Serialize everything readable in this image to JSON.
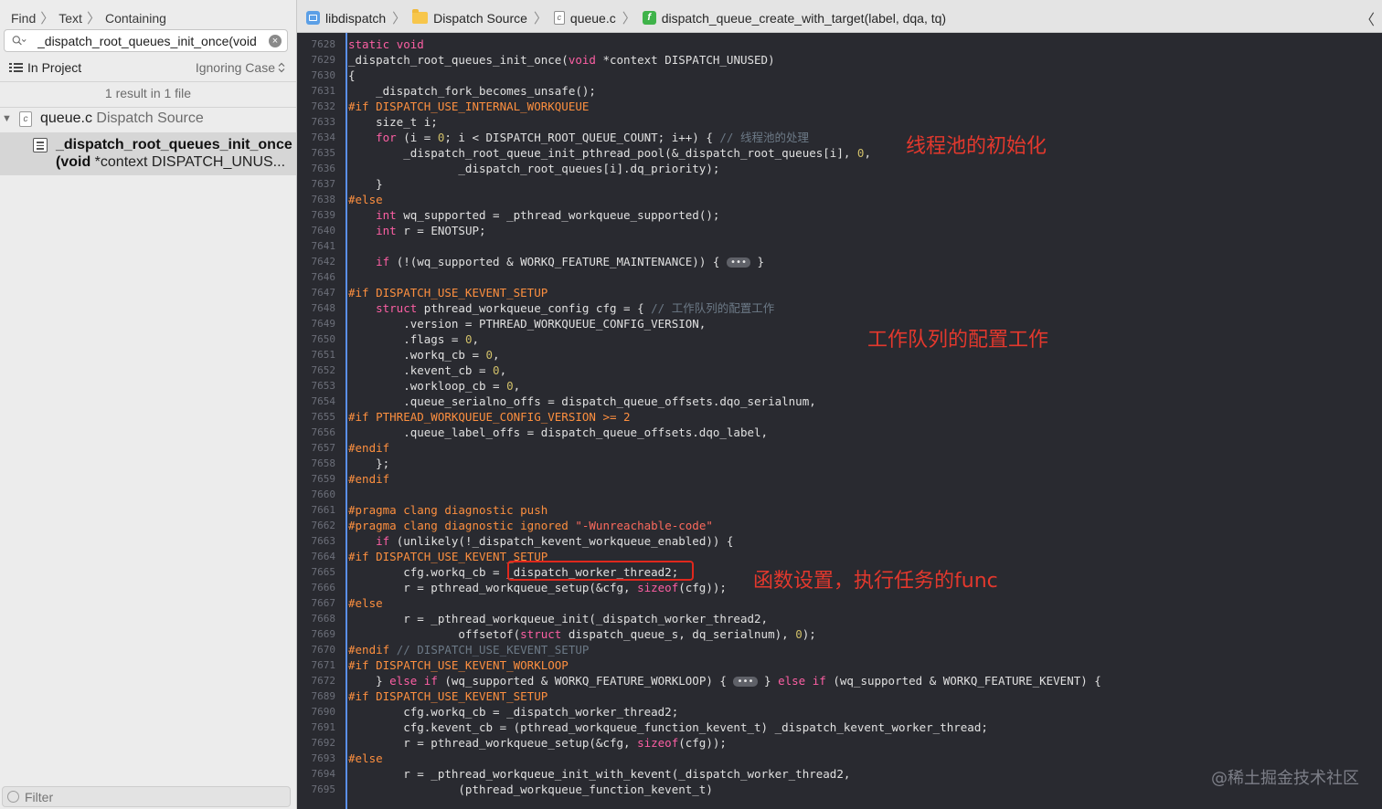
{
  "navigator": {
    "find_path": [
      "Find",
      "Text",
      "Containing"
    ],
    "search": {
      "value": "_dispatch_root_queues_init_once(void",
      "placeholder": ""
    },
    "scope": "In Project",
    "match_mode": "Ignoring Case",
    "summary": "1 result in 1 file",
    "file": {
      "name": "queue.c",
      "group": "Dispatch Source"
    },
    "result": {
      "line1": "_dispatch_root_queues_init_once",
      "line2_bold": "(void",
      "line2_rest": " *context DISPATCH_UNUS..."
    },
    "filter_placeholder": "Filter"
  },
  "jump_bar": {
    "project": "libdispatch",
    "group": "Dispatch Source",
    "file": "queue.c",
    "symbol": "dispatch_queue_create_with_target(label, dqa, tq)"
  },
  "code_lines": [
    {
      "n": "7628",
      "code": "static void"
    },
    {
      "n": "7629",
      "code": "_dispatch_root_queues_init_once(void *context DISPATCH_UNUSED)"
    },
    {
      "n": "7630",
      "code": "{"
    },
    {
      "n": "7631",
      "code": "    _dispatch_fork_becomes_unsafe();"
    },
    {
      "n": "7632",
      "code": "#if DISPATCH_USE_INTERNAL_WORKQUEUE"
    },
    {
      "n": "7633",
      "code": "    size_t i;"
    },
    {
      "n": "7634",
      "code": "    for (i = 0; i < DISPATCH_ROOT_QUEUE_COUNT; i++) { // 线程池的处理"
    },
    {
      "n": "7635",
      "code": "        _dispatch_root_queue_init_pthread_pool(&_dispatch_root_queues[i], 0,"
    },
    {
      "n": "7636",
      "code": "                _dispatch_root_queues[i].dq_priority);"
    },
    {
      "n": "7637",
      "code": "    }"
    },
    {
      "n": "7638",
      "code": "#else"
    },
    {
      "n": "7639",
      "code": "    int wq_supported = _pthread_workqueue_supported();"
    },
    {
      "n": "7640",
      "code": "    int r = ENOTSUP;"
    },
    {
      "n": "7641",
      "code": ""
    },
    {
      "n": "7642",
      "code": "    if (!(wq_supported & WORKQ_FEATURE_MAINTENANCE)) { ••• }"
    },
    {
      "n": "7646",
      "code": ""
    },
    {
      "n": "7647",
      "code": "#if DISPATCH_USE_KEVENT_SETUP"
    },
    {
      "n": "7648",
      "code": "    struct pthread_workqueue_config cfg = { // 工作队列的配置工作"
    },
    {
      "n": "7649",
      "code": "        .version = PTHREAD_WORKQUEUE_CONFIG_VERSION,"
    },
    {
      "n": "7650",
      "code": "        .flags = 0,"
    },
    {
      "n": "7651",
      "code": "        .workq_cb = 0,"
    },
    {
      "n": "7652",
      "code": "        .kevent_cb = 0,"
    },
    {
      "n": "7653",
      "code": "        .workloop_cb = 0,"
    },
    {
      "n": "7654",
      "code": "        .queue_serialno_offs = dispatch_queue_offsets.dqo_serialnum,"
    },
    {
      "n": "7655",
      "code": "#if PTHREAD_WORKQUEUE_CONFIG_VERSION >= 2"
    },
    {
      "n": "7656",
      "code": "        .queue_label_offs = dispatch_queue_offsets.dqo_label,"
    },
    {
      "n": "7657",
      "code": "#endif"
    },
    {
      "n": "7658",
      "code": "    };"
    },
    {
      "n": "7659",
      "code": "#endif"
    },
    {
      "n": "7660",
      "code": ""
    },
    {
      "n": "7661",
      "code": "#pragma clang diagnostic push"
    },
    {
      "n": "7662",
      "code": "#pragma clang diagnostic ignored \"-Wunreachable-code\""
    },
    {
      "n": "7663",
      "code": "    if (unlikely(!_dispatch_kevent_workqueue_enabled)) {"
    },
    {
      "n": "7664",
      "code": "#if DISPATCH_USE_KEVENT_SETUP"
    },
    {
      "n": "7665",
      "code": "        cfg.workq_cb = _dispatch_worker_thread2;"
    },
    {
      "n": "7666",
      "code": "        r = pthread_workqueue_setup(&cfg, sizeof(cfg));"
    },
    {
      "n": "7667",
      "code": "#else"
    },
    {
      "n": "7668",
      "code": "        r = _pthread_workqueue_init(_dispatch_worker_thread2,"
    },
    {
      "n": "7669",
      "code": "                offsetof(struct dispatch_queue_s, dq_serialnum), 0);"
    },
    {
      "n": "7670",
      "code": "#endif // DISPATCH_USE_KEVENT_SETUP"
    },
    {
      "n": "7671",
      "code": "#if DISPATCH_USE_KEVENT_WORKLOOP"
    },
    {
      "n": "7672",
      "code": "    } else if (wq_supported & WORKQ_FEATURE_WORKLOOP) { ••• } else if (wq_supported & WORKQ_FEATURE_KEVENT) {"
    },
    {
      "n": "7689",
      "code": "#if DISPATCH_USE_KEVENT_SETUP"
    },
    {
      "n": "7690",
      "code": "        cfg.workq_cb = _dispatch_worker_thread2;"
    },
    {
      "n": "7691",
      "code": "        cfg.kevent_cb = (pthread_workqueue_function_kevent_t) _dispatch_kevent_worker_thread;"
    },
    {
      "n": "7692",
      "code": "        r = pthread_workqueue_setup(&cfg, sizeof(cfg));"
    },
    {
      "n": "7693",
      "code": "#else"
    },
    {
      "n": "7694",
      "code": "        r = _pthread_workqueue_init_with_kevent(_dispatch_worker_thread2,"
    },
    {
      "n": "7695",
      "code": "                (pthread_workqueue_function_kevent_t)"
    }
  ],
  "annotations": {
    "thread_pool": "线程池的初始化",
    "workqueue_config": "工作队列的配置工作",
    "func_setup": "函数设置，执行任务的func"
  },
  "watermark": "@稀土掘金技术社区",
  "colors": {
    "editor_bg": "#292a30",
    "keyword": "#fc5fa3",
    "preprocessor": "#fd8f3f",
    "number": "#d0bf69",
    "comment": "#6c7986",
    "string": "#fc6a5d",
    "annotation": "#e3382d"
  }
}
